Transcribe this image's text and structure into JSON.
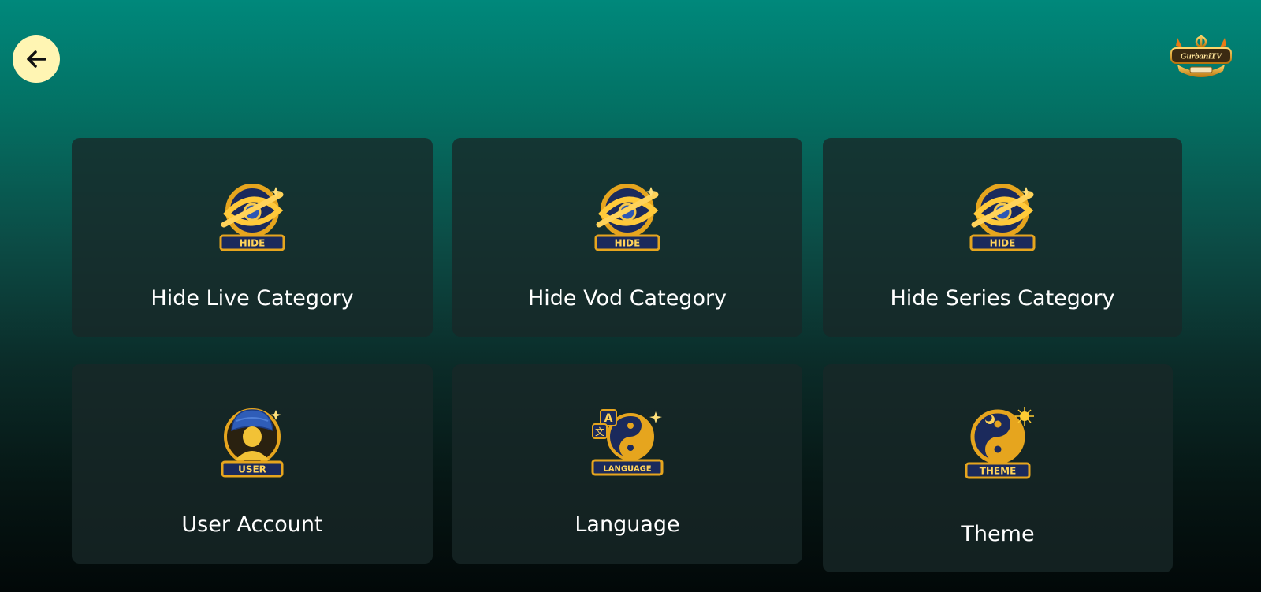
{
  "header": {
    "back_icon": "arrow-left-icon",
    "logo_text": "GurbaniTV"
  },
  "colors": {
    "accent_yellow": "#fff5b3",
    "gold": "#e6a51e",
    "navy": "#1b2a5c",
    "card_bg": "#182828"
  },
  "cards": [
    {
      "label": "Hide Live Category",
      "icon": "hide-icon",
      "badge": "HIDE"
    },
    {
      "label": "Hide Vod Category",
      "icon": "hide-icon",
      "badge": "HIDE"
    },
    {
      "label": "Hide Series Category",
      "icon": "hide-icon",
      "badge": "HIDE"
    },
    {
      "label": "User Account",
      "icon": "user-icon",
      "badge": "USER"
    },
    {
      "label": "Language",
      "icon": "language-icon",
      "badge": "LANGUAGE"
    },
    {
      "label": "Theme",
      "icon": "theme-icon",
      "badge": "THEME"
    }
  ]
}
